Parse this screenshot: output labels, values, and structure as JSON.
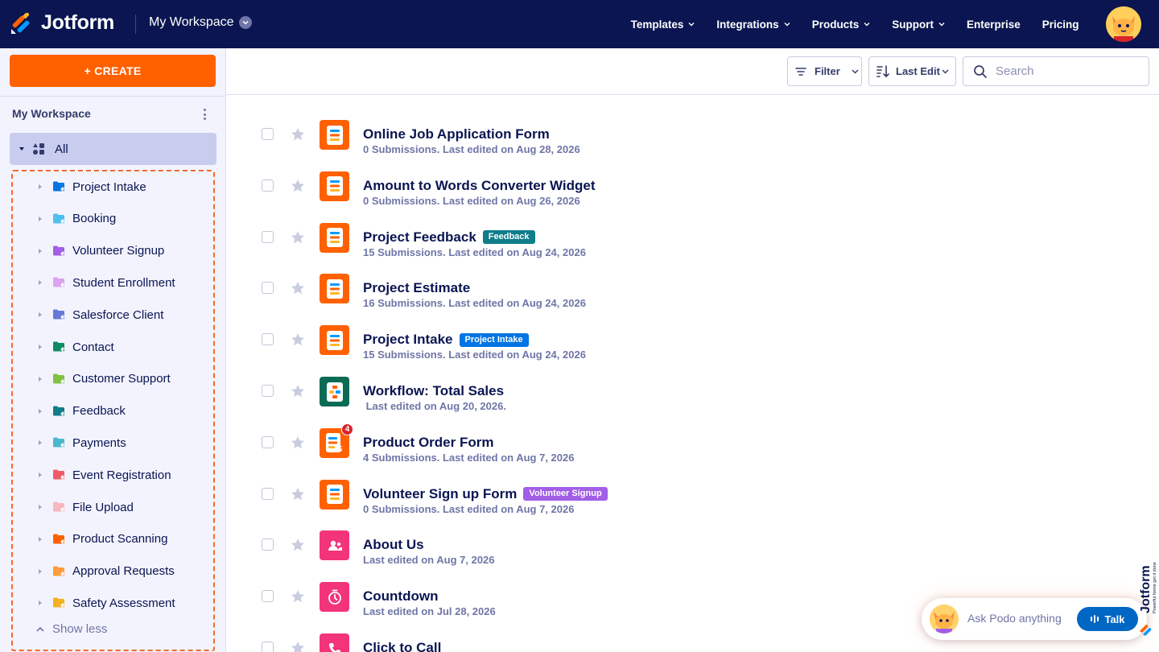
{
  "brand": {
    "name": "Jotform",
    "tagline": "Powerful forms get it done"
  },
  "header": {
    "workspace_title": "My Workspace",
    "nav": [
      "Templates",
      "Integrations",
      "Products",
      "Support",
      "Enterprise",
      "Pricing"
    ]
  },
  "sidebar": {
    "create_label": "+ CREATE",
    "workspace_label": "My Workspace",
    "all_label": "All",
    "folders": [
      {
        "label": "Project Intake",
        "color": "#0075e3"
      },
      {
        "label": "Booking",
        "color": "#4fbfef"
      },
      {
        "label": "Volunteer Signup",
        "color": "#a15ee6"
      },
      {
        "label": "Student Enrollment",
        "color": "#dba3f0"
      },
      {
        "label": "Salesforce Client",
        "color": "#6878d6"
      },
      {
        "label": "Contact",
        "color": "#0b8a63"
      },
      {
        "label": "Customer Support",
        "color": "#7fc241"
      },
      {
        "label": "Feedback",
        "color": "#0f7d8a"
      },
      {
        "label": "Payments",
        "color": "#4ab8cf"
      },
      {
        "label": "Event Registration",
        "color": "#f05a68"
      },
      {
        "label": "File Upload",
        "color": "#f7b8c0"
      },
      {
        "label": "Product Scanning",
        "color": "#ff6100"
      },
      {
        "label": "Approval Requests",
        "color": "#ff9c3b"
      },
      {
        "label": "Safety Assessment",
        "color": "#f5b01e"
      }
    ],
    "show_less_label": "Show less"
  },
  "toolbar": {
    "filter_label": "Filter",
    "sort_label": "Last Edit",
    "search_placeholder": "Search"
  },
  "forms": [
    {
      "title": "Online Job Application Form",
      "meta": "0 Submissions. Last edited on Aug 28, 2026",
      "type": "form",
      "tag": "",
      "tag_color": ""
    },
    {
      "title": "Amount to Words Converter Widget",
      "meta": "0 Submissions. Last edited on Aug 26, 2026",
      "type": "form",
      "tag": "",
      "tag_color": ""
    },
    {
      "title": "Project Feedback",
      "meta": "15 Submissions. Last edited on Aug 24, 2026",
      "type": "form",
      "tag": "Feedback",
      "tag_color": "#0f7d8a"
    },
    {
      "title": "Project Estimate",
      "meta": "16 Submissions. Last edited on Aug 24, 2026",
      "type": "form",
      "tag": "",
      "tag_color": ""
    },
    {
      "title": "Project Intake",
      "meta": "15 Submissions. Last edited on Aug 24, 2026",
      "type": "form",
      "tag": "Project Intake",
      "tag_color": "#0075e3"
    },
    {
      "title": "Workflow: Total Sales",
      "meta": " Last edited on Aug 20, 2026.",
      "type": "workflow",
      "tag": "",
      "tag_color": ""
    },
    {
      "title": "Product Order Form",
      "meta": "4 Submissions. Last edited on Aug 7, 2026",
      "type": "payment",
      "tag": "",
      "tag_color": "",
      "badge": "4"
    },
    {
      "title": "Volunteer Sign up Form",
      "meta": "0 Submissions. Last edited on Aug 7, 2026",
      "type": "form",
      "tag": "Volunteer Signup",
      "tag_color": "#a15ee6"
    },
    {
      "title": "About Us",
      "meta": "Last edited on Aug 7, 2026",
      "type": "app-about",
      "tag": "",
      "tag_color": ""
    },
    {
      "title": "Countdown",
      "meta": "Last edited on Jul 28, 2026",
      "type": "app-clock",
      "tag": "",
      "tag_color": ""
    },
    {
      "title": "Click to Call",
      "meta": "",
      "type": "app-phone",
      "tag": "",
      "tag_color": ""
    }
  ],
  "assistant": {
    "prompt": "Ask Podo anything",
    "talk_label": "Talk"
  },
  "colors": {
    "navy": "#0a1551",
    "orange": "#ff6100",
    "pink": "#f4347a",
    "green": "#0b6b55",
    "blue": "#0066c3"
  }
}
